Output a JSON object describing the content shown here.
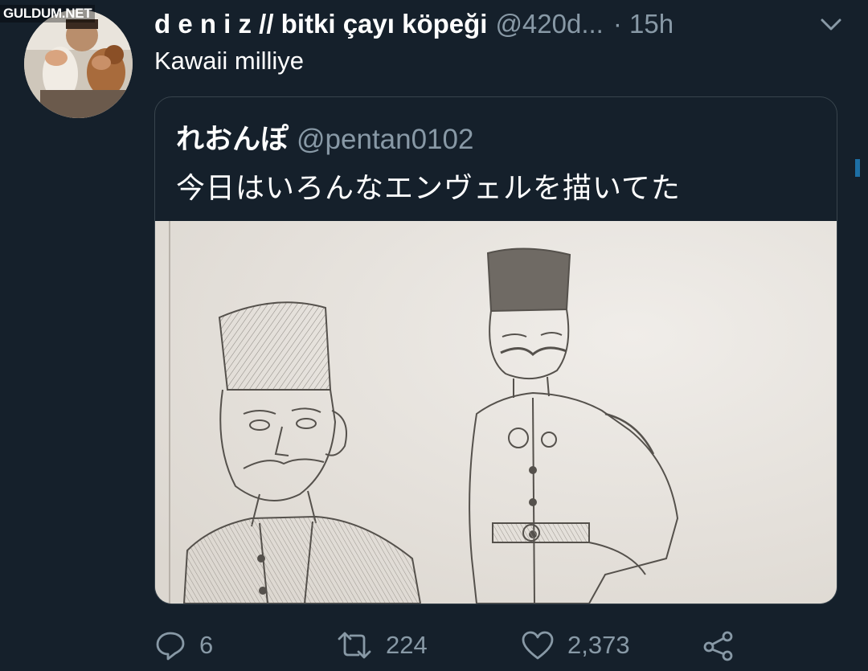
{
  "watermark": "GULDUM.NET",
  "tweet": {
    "display_name": "d e n i z // bitki çayı köpeği",
    "handle": "@420d...",
    "time": "· 15h",
    "text": "Kawaii milliye"
  },
  "quoted_tweet": {
    "display_name": "れおんぽ",
    "handle": "@pentan0102",
    "text": "今日はいろんなエンヴェルを描いてた"
  },
  "actions": {
    "reply_count": "6",
    "retweet_count": "224",
    "like_count": "2,373"
  },
  "icons": {
    "reply": "reply-icon",
    "retweet": "retweet-icon",
    "like": "heart-icon",
    "share": "share-icon",
    "more": "chevron-down-icon"
  },
  "colors": {
    "background": "#15202b",
    "secondary_text": "#8899a6",
    "border": "#38444d"
  }
}
